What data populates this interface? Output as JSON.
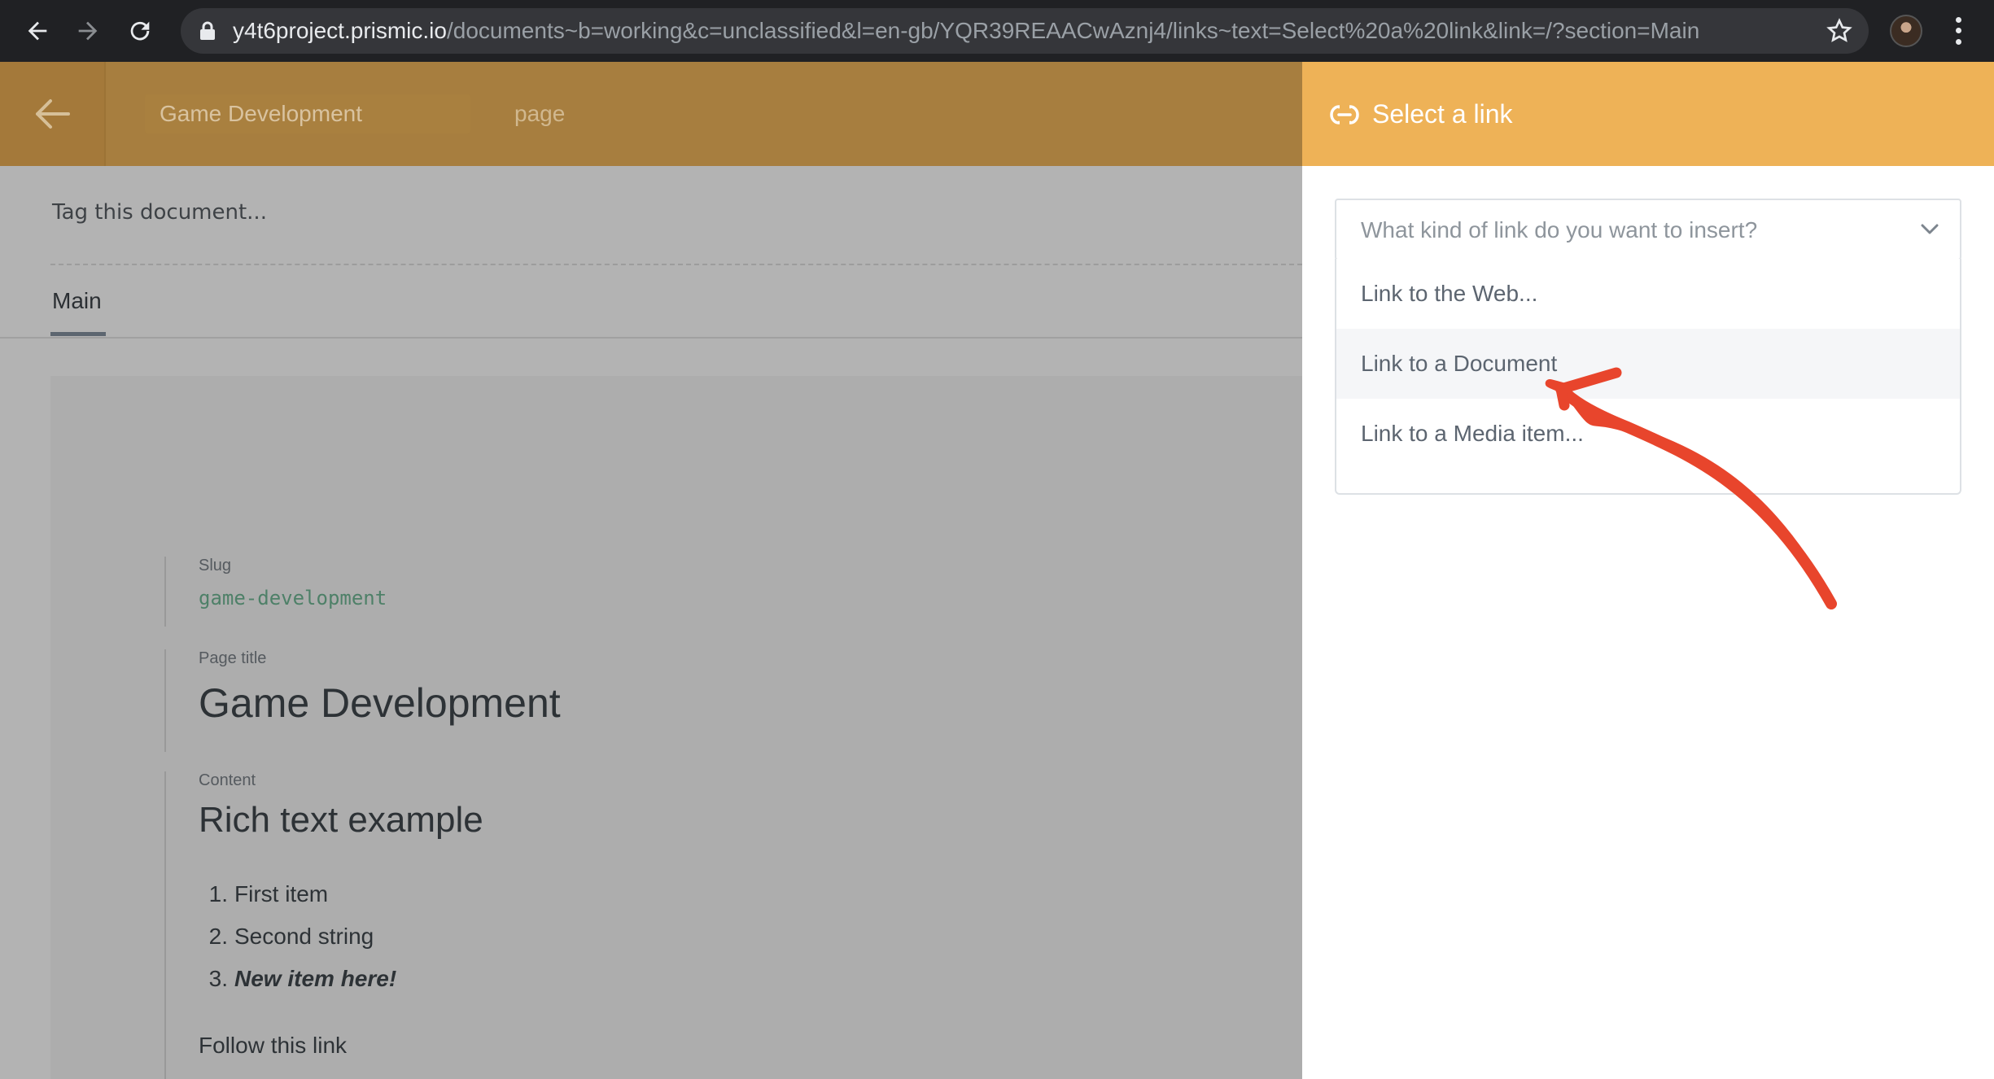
{
  "browser": {
    "url_host": "y4t6project.prismic.io",
    "url_path": "/documents~b=working&c=unclassified&l=en-gb/YQR39REAACwAznj4/links~text=Select%20a%20link&link=/?section=Main",
    "icons": [
      "back-arrow-icon",
      "forward-arrow-icon",
      "reload-icon",
      "lock-icon",
      "star-icon",
      "profile-avatar",
      "kebab-menu-icon"
    ]
  },
  "editor": {
    "doc_title": "Game Development",
    "doc_type": "page",
    "tag_placeholder": "Tag this document...",
    "tab_main": "Main",
    "slug_label": "Slug",
    "slug_value": "game-development",
    "page_title_label": "Page title",
    "page_title_value": "Game Development",
    "content_label": "Content",
    "content_heading": "Rich text example",
    "list": [
      {
        "num": "1.",
        "text": "First item"
      },
      {
        "num": "2.",
        "text": "Second string"
      },
      {
        "num": "3.",
        "text": "New item here!"
      }
    ],
    "follow_link": "Follow this link"
  },
  "panel": {
    "title": "Select a link",
    "select_placeholder": "What kind of link do you want to insert?",
    "options": [
      "Link to the Web...",
      "Link to a Document",
      "Link to a Media item..."
    ],
    "highlighted_option": 1
  },
  "colors": {
    "panel_header": "#eeb257",
    "editor_header_dimmed": "#a77e3f",
    "annotation_arrow": "#e8452c",
    "slug_green": "#4e8068"
  }
}
